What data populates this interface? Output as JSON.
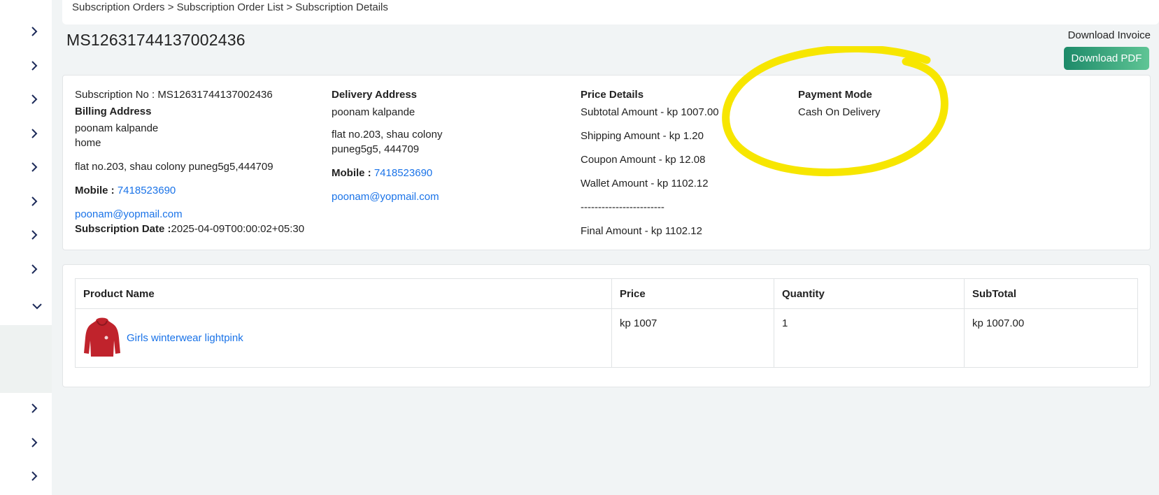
{
  "breadcrumb": "Subscription Orders > Subscription Order List > Subscription Details",
  "page_title": "MS12631744137002436",
  "download": {
    "label": "Download Invoice",
    "button": "Download PDF"
  },
  "subscription": {
    "no_label": "Subscription No :",
    "no_value": "MS12631744137002436",
    "billing_header": "Billing Address",
    "billing_name": "poonam kalpande",
    "billing_type": "home",
    "billing_address": "flat no.203, shau colony puneg5g5,444709",
    "mobile_label": "Mobile :",
    "mobile": "7418523690",
    "email": "poonam@yopmail.com",
    "date_label": "Subscription Date :",
    "date": "2025-04-09T00:00:02+05:30"
  },
  "delivery": {
    "header": "Delivery Address",
    "name": "poonam kalpande",
    "address_line1": "flat no.203, shau colony",
    "address_line2": "puneg5g5, 444709",
    "mobile_label": "Mobile :",
    "mobile": "7418523690",
    "email": "poonam@yopmail.com"
  },
  "price": {
    "header": "Price Details",
    "subtotal": "Subtotal Amount - kp 1007.00",
    "shipping": "Shipping Amount - kp 1.20",
    "coupon": "Coupon Amount - kp 12.08",
    "wallet": "Wallet Amount - kp 1102.12",
    "divider": "------------------------",
    "final": "Final Amount - kp  1102.12"
  },
  "payment": {
    "header": "Payment Mode",
    "value": "Cash On Delivery"
  },
  "table": {
    "headers": [
      "Product Name",
      "Price",
      "Quantity",
      "SubTotal"
    ],
    "rows": [
      {
        "product": "Girls winterwear lightpink",
        "price": "kp 1007",
        "quantity": "1",
        "subtotal": "kp 1007.00"
      }
    ]
  },
  "colors": {
    "accent": "#1d8a69",
    "link": "#1a73e8",
    "annotation": "#f7e600",
    "product_red": "#c0232c"
  }
}
